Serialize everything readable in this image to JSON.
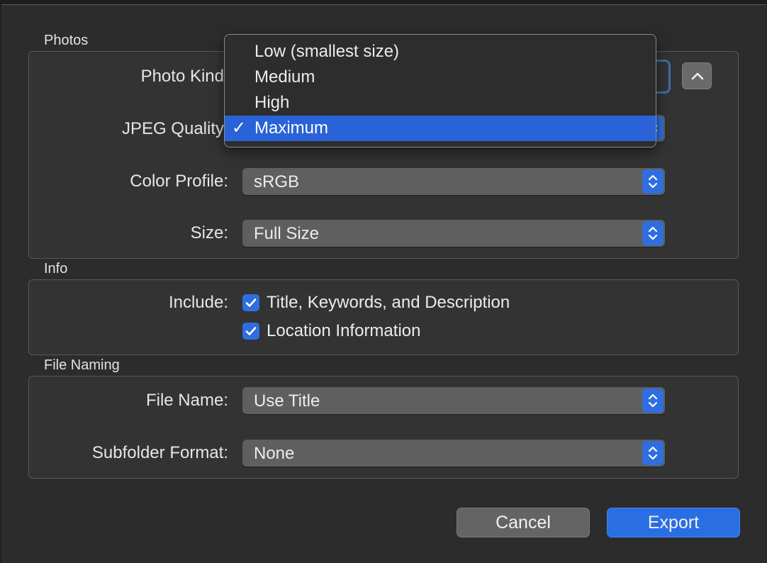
{
  "sections": {
    "photos": {
      "title": "Photos"
    },
    "info": {
      "title": "Info"
    },
    "file_naming": {
      "title": "File Naming"
    }
  },
  "photos": {
    "photo_kind_label": "Photo Kind",
    "jpeg_quality_label": "JPEG Quality",
    "color_profile_label": "Color Profile:",
    "color_profile_value": "sRGB",
    "size_label": "Size:",
    "size_value": "Full Size"
  },
  "info": {
    "include_label": "Include:",
    "checkboxes": [
      {
        "label": "Title, Keywords, and Description",
        "checked": true
      },
      {
        "label": "Location Information",
        "checked": true
      }
    ]
  },
  "file_naming": {
    "file_name_label": "File Name:",
    "file_name_value": "Use Title",
    "subfolder_label": "Subfolder Format:",
    "subfolder_value": "None"
  },
  "quality_menu": {
    "items": [
      {
        "label": "Low (smallest size)",
        "selected": false
      },
      {
        "label": "Medium",
        "selected": false
      },
      {
        "label": "High",
        "selected": false
      },
      {
        "label": "Maximum",
        "selected": true
      }
    ],
    "check_glyph": "✓"
  },
  "buttons": {
    "cancel": "Cancel",
    "export": "Export"
  },
  "colors": {
    "accent": "#2a6ee4",
    "background": "#2c2c2c",
    "popup": "#5f5f5f"
  },
  "icons": {
    "stepper": "up-down-chevron-icon",
    "collapse": "chevron-up-icon",
    "checkmark": "checkmark-icon"
  }
}
